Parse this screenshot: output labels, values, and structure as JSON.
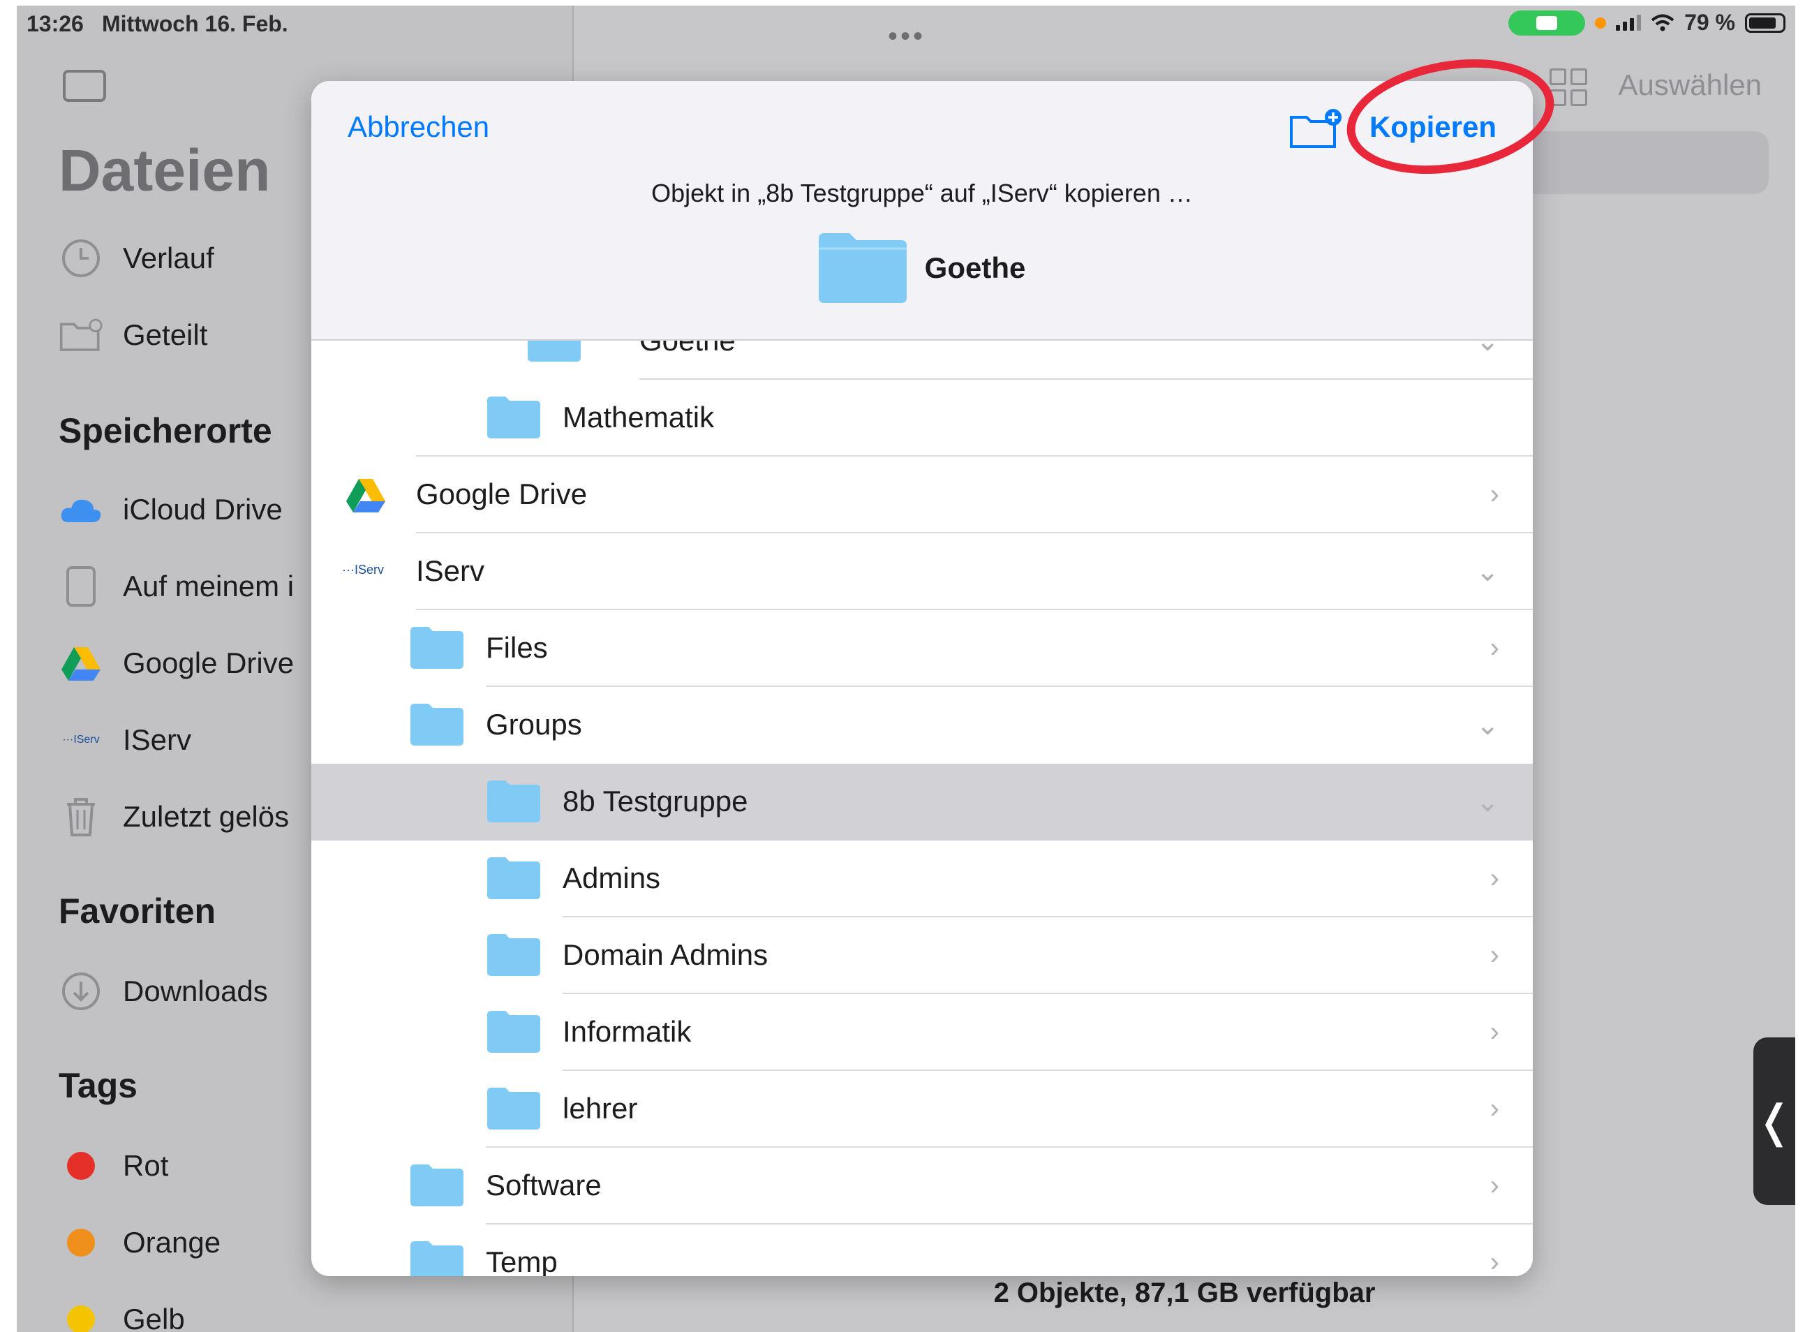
{
  "status": {
    "time": "13:26",
    "date": "Mittwoch 16. Feb.",
    "battery": "79 %"
  },
  "sidebar": {
    "title": "Dateien",
    "recents": "Verlauf",
    "shared": "Geteilt",
    "locations_header": "Speicherorte",
    "locations": [
      "iCloud Drive",
      "Auf meinem i",
      "Google Drive",
      "IServ",
      "Zuletzt gelös"
    ],
    "favorites_header": "Favoriten",
    "favorites": [
      "Downloads"
    ],
    "tags_header": "Tags",
    "tags": [
      {
        "label": "Rot",
        "color": "#e5302a"
      },
      {
        "label": "Orange",
        "color": "#f0901c"
      },
      {
        "label": "Gelb",
        "color": "#f5c400"
      }
    ]
  },
  "main": {
    "select_label": "Auswählen",
    "footer": "2 Objekte, 87,1 GB verfügbar",
    "dots": "•••"
  },
  "modal": {
    "cancel": "Abbrechen",
    "copy": "Kopieren",
    "subtitle": "Objekt in „8b Testgruppe“ auf „IServ“ kopieren …",
    "destination": "Goethe",
    "folder_color": "#7fcbf5",
    "accent": "#007aff",
    "rows": [
      {
        "label": "Goethe",
        "chevron": "⌄"
      },
      {
        "label": "Mathematik",
        "chevron": ""
      },
      {
        "label": "Google Drive",
        "chevron": "›"
      },
      {
        "label": "IServ",
        "chevron": "⌄"
      },
      {
        "label": "Files",
        "chevron": "›"
      },
      {
        "label": "Groups",
        "chevron": "⌄"
      },
      {
        "label": "8b Testgruppe",
        "chevron": "⌄"
      },
      {
        "label": "Admins",
        "chevron": "›"
      },
      {
        "label": "Domain Admins",
        "chevron": "›"
      },
      {
        "label": "Informatik",
        "chevron": "›"
      },
      {
        "label": "lehrer",
        "chevron": "›"
      },
      {
        "label": "Software",
        "chevron": "›"
      },
      {
        "label": "Temp",
        "chevron": "›"
      }
    ]
  }
}
